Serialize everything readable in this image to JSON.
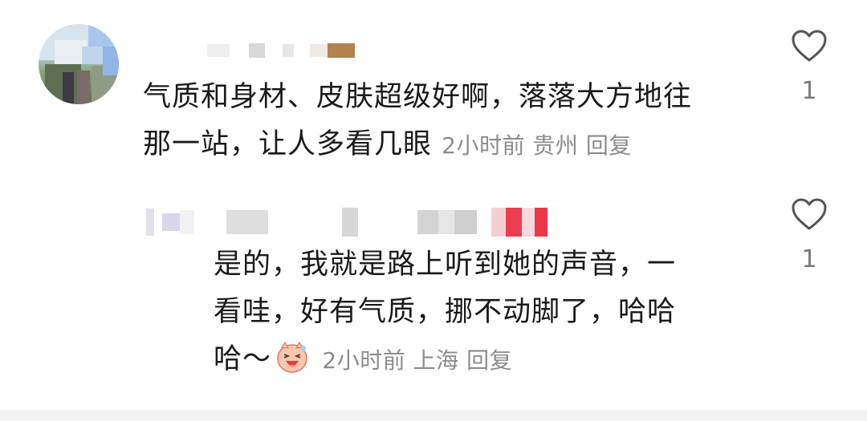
{
  "comments": [
    {
      "text": "气质和身材、皮肤超级好啊，落落大方地往那一站，让人多看几眼",
      "line1": "气质和身材、皮肤超级好啊，落落大方地往",
      "line2": "那一站，让人多看几眼",
      "time": "2小时前",
      "location": "贵州",
      "reply_label": "回复",
      "like_icon": "heart-outline-icon",
      "like_count": "1"
    },
    {
      "line1": "是的，我就是路上听到她的声音，一",
      "line2": "看哇，好有气质，挪不动脚了，哈哈",
      "line3": "哈～",
      "emoji": "laughing-pig-emoji",
      "time": "2小时前",
      "location": "上海",
      "reply_label": "回复",
      "like_icon": "heart-outline-icon",
      "like_count": "1"
    }
  ],
  "colors": {
    "text": "#1a1a1a",
    "meta": "#8c8c8c",
    "heart_stroke": "#555555"
  }
}
